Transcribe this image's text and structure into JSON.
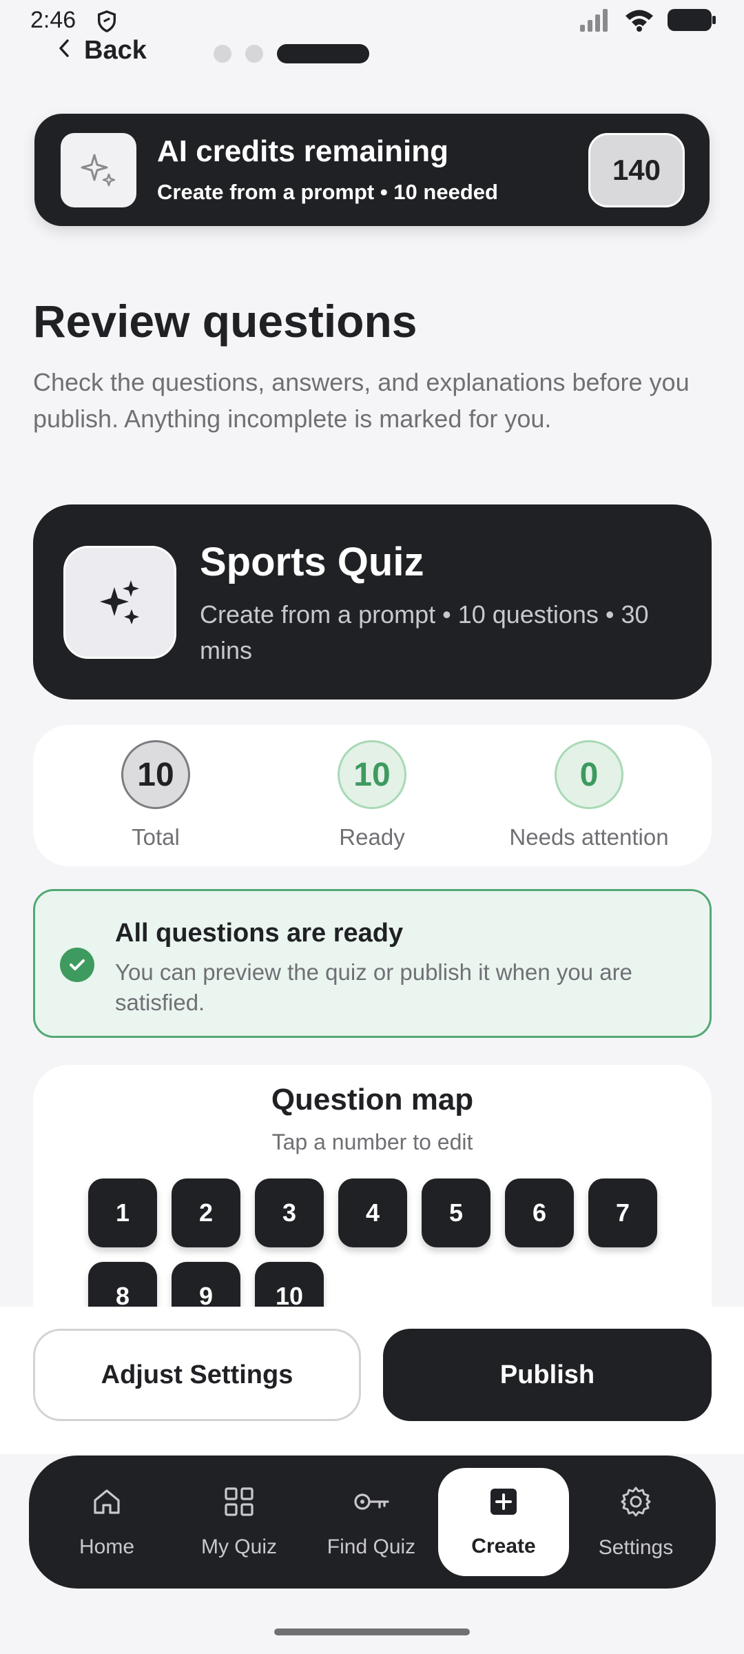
{
  "status_bar": {
    "time": "2:46"
  },
  "nav": {
    "back_label": "Back"
  },
  "credits": {
    "title": "AI credits remaining",
    "subtitle": "Create from a prompt • 10 needed",
    "count": "140"
  },
  "header": {
    "title": "Review questions",
    "description": "Check the questions, answers, and explanations before you publish. Anything incomplete is marked for you."
  },
  "quiz": {
    "title": "Sports Quiz",
    "meta": "Create from a prompt • 10 questions • 30 mins"
  },
  "stats": {
    "total": {
      "value": "10",
      "label": "Total"
    },
    "ready": {
      "value": "10",
      "label": "Ready"
    },
    "attention": {
      "value": "0",
      "label": "Needs attention"
    }
  },
  "banner": {
    "title": "All questions are ready",
    "subtitle": "You can preview the quiz or publish it when you are satisfied."
  },
  "question_map": {
    "title": "Question map",
    "subtitle": "Tap a number to edit",
    "questions": [
      "1",
      "2",
      "3",
      "4",
      "5",
      "6",
      "7",
      "8",
      "9",
      "10"
    ]
  },
  "actions": {
    "adjust_label": "Adjust Settings",
    "publish_label": "Publish"
  },
  "bottom_nav": {
    "items": [
      {
        "label": "Home",
        "icon": "home-icon"
      },
      {
        "label": "My Quiz",
        "icon": "grid-icon"
      },
      {
        "label": "Find Quiz",
        "icon": "key-icon"
      },
      {
        "label": "Create",
        "icon": "plus-square-icon",
        "active": true
      },
      {
        "label": "Settings",
        "icon": "gear-icon"
      }
    ]
  },
  "colors": {
    "dark": "#202124",
    "success": "#3e9a5e",
    "background": "#f5f5f8"
  }
}
